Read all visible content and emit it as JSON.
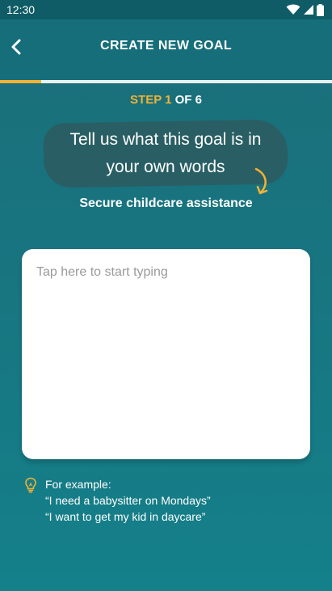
{
  "status_bar": {
    "time": "12:30"
  },
  "header": {
    "title": "CREATE NEW GOAL"
  },
  "progress": {
    "current_step": 1,
    "total_steps": 6,
    "fraction": 0.125
  },
  "step": {
    "current_label": "STEP 1",
    "of_label": "OF 6"
  },
  "prompt": {
    "line1": "Tell us what this goal is in",
    "line2": "your own words"
  },
  "goal_name": "Secure childcare assistance",
  "input": {
    "placeholder": "Tap here to start typing",
    "value": ""
  },
  "tip": {
    "heading": "For example:",
    "examples": [
      "“I need a babysitter on Mondays”",
      "“I want to get my kid in daycare”"
    ]
  },
  "colors": {
    "accent": "#f2b233",
    "background": "#187580",
    "bubble": "#295f64"
  },
  "icons": {
    "back": "chevron-left-icon",
    "tip": "lightbulb-icon",
    "wifi": "wifi-icon",
    "signal": "signal-icon",
    "battery": "battery-icon"
  }
}
